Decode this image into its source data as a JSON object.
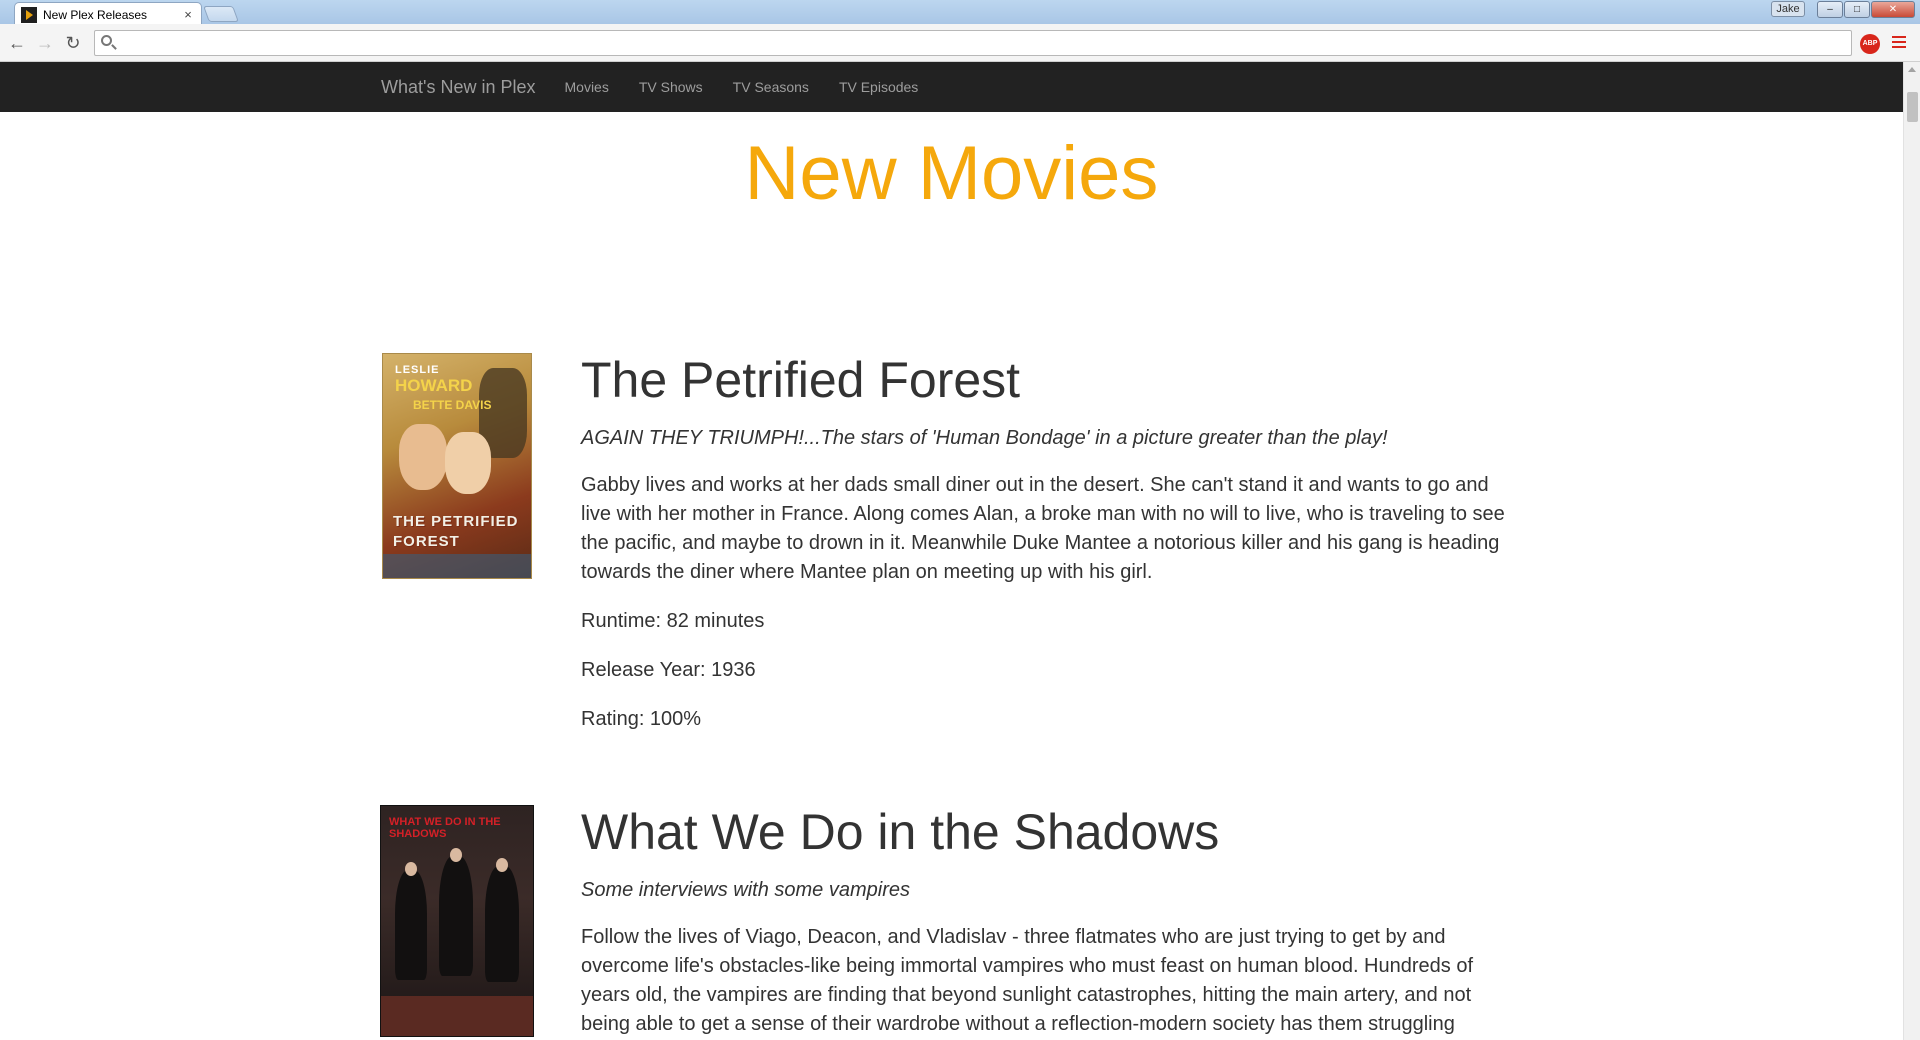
{
  "browser": {
    "tab_title": "New Plex Releases",
    "tab_close": "×",
    "profile_name": "Jake",
    "minimize": "–",
    "maximize": "□",
    "close": "✕",
    "back": "←",
    "forward": "→",
    "reload": "↻",
    "address_value": "",
    "adblock_label": "ABP"
  },
  "nav": {
    "brand": "What's New in Plex",
    "links": [
      "Movies",
      "TV Shows",
      "TV Seasons",
      "TV Episodes"
    ]
  },
  "page": {
    "title": "New Movies"
  },
  "colors": {
    "accent": "#f5a80c",
    "navbar": "#222222",
    "nav_text": "#9d9d9d",
    "body_text": "#333333"
  },
  "movies": [
    {
      "title": "The Petrified Forest",
      "tagline": "AGAIN THEY TRIUMPH!...The stars of 'Human Bondage' in a picture greater than the play!",
      "summary": "Gabby lives and works at her dads small diner out in the desert. She can't stand it and wants to go and live with her mother in France. Along comes Alan, a broke man with no will to live, who is traveling to see the pacific, and maybe to drown in it. Meanwhile Duke Mantee a notorious killer and his gang is heading towards the diner where Mantee plan on meeting up with his girl.",
      "runtime": "Runtime: 82 minutes",
      "release_year": "Release Year: 1936",
      "rating": "Rating: 100%",
      "poster": {
        "line1": "LESLIE",
        "line2": "HOWARD",
        "line3": "BETTE DAVIS",
        "line4": "THE PETRIFIED FOREST"
      }
    },
    {
      "title": "What We Do in the Shadows",
      "tagline": "Some interviews with some vampires",
      "summary": "Follow the lives of Viago, Deacon, and Vladislav - three flatmates who are just trying to get by and overcome life's obstacles-like being immortal vampires who must feast on human blood. Hundreds of years old, the vampires are finding that beyond sunlight catastrophes, hitting the main artery, and not being able to get a sense of their wardrobe without a reflection-modern society has them struggling",
      "poster": {
        "title": "WHAT WE DO IN THE SHADOWS"
      }
    }
  ]
}
